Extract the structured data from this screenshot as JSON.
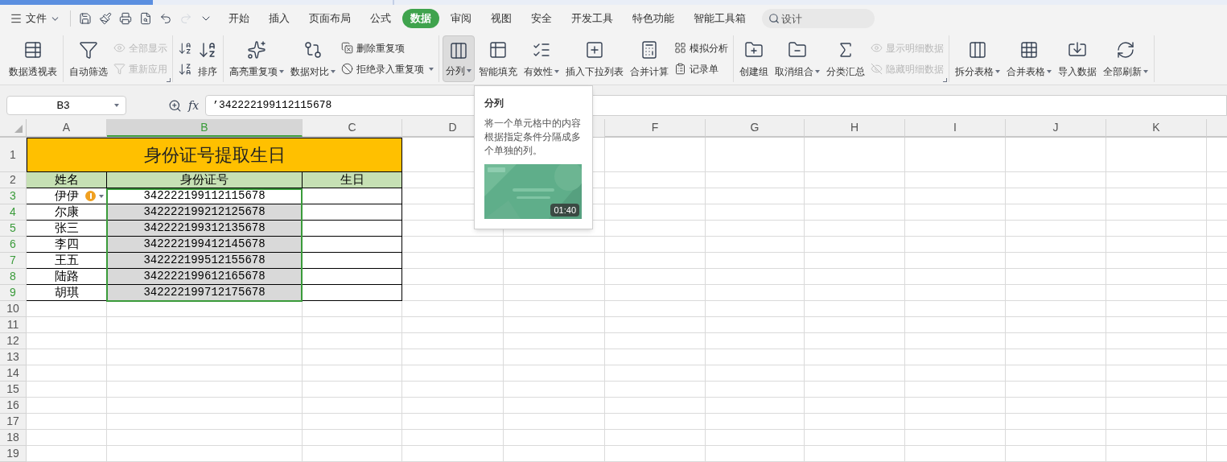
{
  "menu": {
    "file_label": "文件",
    "tabs": [
      {
        "label": "开始",
        "selected": false
      },
      {
        "label": "插入",
        "selected": false
      },
      {
        "label": "页面布局",
        "selected": false
      },
      {
        "label": "公式",
        "selected": false
      },
      {
        "label": "数据",
        "selected": true
      },
      {
        "label": "审阅",
        "selected": false
      },
      {
        "label": "视图",
        "selected": false
      },
      {
        "label": "安全",
        "selected": false
      },
      {
        "label": "开发工具",
        "selected": false
      },
      {
        "label": "特色功能",
        "selected": false
      },
      {
        "label": "智能工具箱",
        "selected": false
      }
    ],
    "search": {
      "placeholder": "设计"
    }
  },
  "ribbon": [
    {
      "launcher": false,
      "items": [
        {
          "kind": "large",
          "label": "数据透视表",
          "dropdown": false,
          "selected": false
        }
      ]
    },
    {
      "launcher": true,
      "items": [
        {
          "kind": "large",
          "label": "自动筛选",
          "dropdown": false,
          "selected": false
        },
        {
          "kind": "stack",
          "entries": [
            {
              "label": "全部显示",
              "disabled": true,
              "dropdown": false
            },
            {
              "label": "重新应用",
              "disabled": true,
              "dropdown": false
            }
          ]
        }
      ]
    },
    {
      "launcher": false,
      "items": [
        {
          "kind": "icons"
        },
        {
          "kind": "large",
          "label": "排序",
          "dropdown": false,
          "selected": false
        }
      ]
    },
    {
      "launcher": false,
      "items": [
        {
          "kind": "large",
          "label": "高亮重复项",
          "dropdown": true,
          "selected": false
        },
        {
          "kind": "large",
          "label": "数据对比",
          "dropdown": true,
          "selected": false
        },
        {
          "kind": "stack",
          "entries": [
            {
              "label": "删除重复项",
              "disabled": false,
              "dropdown": false
            },
            {
              "label": "拒绝录入重复项",
              "disabled": false,
              "dropdown": true
            }
          ]
        }
      ]
    },
    {
      "launcher": false,
      "items": [
        {
          "kind": "large",
          "label": "分列",
          "dropdown": true,
          "selected": true
        },
        {
          "kind": "large",
          "label": "智能填充",
          "dropdown": false,
          "selected": false
        },
        {
          "kind": "large",
          "label": "有效性",
          "dropdown": true,
          "selected": false
        },
        {
          "kind": "large",
          "label": "插入下拉列表",
          "dropdown": false,
          "selected": false
        },
        {
          "kind": "large",
          "label": "合并计算",
          "dropdown": false,
          "selected": false
        },
        {
          "kind": "stack",
          "entries": [
            {
              "label": "模拟分析",
              "disabled": false,
              "dropdown": false
            },
            {
              "label": "记录单",
              "disabled": false,
              "dropdown": false
            }
          ]
        }
      ]
    },
    {
      "launcher": true,
      "items": [
        {
          "kind": "large",
          "label": "创建组",
          "dropdown": false,
          "selected": false
        },
        {
          "kind": "large",
          "label": "取消组合",
          "dropdown": true,
          "selected": false
        },
        {
          "kind": "large",
          "label": "分类汇总",
          "dropdown": false,
          "selected": false
        },
        {
          "kind": "stack",
          "entries": [
            {
              "label": "显示明细数据",
              "disabled": true,
              "dropdown": false
            },
            {
              "label": "隐藏明细数据",
              "disabled": true,
              "dropdown": false
            }
          ]
        }
      ]
    },
    {
      "launcher": false,
      "items": [
        {
          "kind": "large",
          "label": "拆分表格",
          "dropdown": true,
          "selected": false
        },
        {
          "kind": "large",
          "label": "合并表格",
          "dropdown": true,
          "selected": false
        },
        {
          "kind": "large",
          "label": "导入数据",
          "dropdown": false,
          "selected": false
        },
        {
          "kind": "large",
          "label": "全部刷新",
          "dropdown": true,
          "selected": false
        }
      ]
    }
  ],
  "formula_bar": {
    "name_box": "B3",
    "formula": "’342222199112115678",
    "fx_label": "fx"
  },
  "tooltip": {
    "title": "分列",
    "body": "将一个单元格中的内容根据指定条件分隔成多个单独的列。",
    "duration": "01:40"
  },
  "sheet": {
    "columns": [
      {
        "label": "A",
        "selected": false
      },
      {
        "label": "B",
        "selected": true
      },
      {
        "label": "C",
        "selected": false
      },
      {
        "label": "D",
        "selected": false
      },
      {
        "kind": "covered"
      },
      {
        "label": "F",
        "selected": false
      },
      {
        "label": "G",
        "selected": false
      },
      {
        "label": "H",
        "selected": false
      },
      {
        "label": "I",
        "selected": false
      },
      {
        "label": "J",
        "selected": false
      },
      {
        "label": "K",
        "selected": false
      }
    ],
    "title_row": {
      "number": "1",
      "text": "身份证号提取生日"
    },
    "header_row": {
      "number": "2",
      "cells": [
        "姓名",
        "身份证号",
        "生日"
      ]
    },
    "rows": [
      {
        "number": "3",
        "name": "伊伊",
        "id": "342222199112115678",
        "selected": true,
        "active": true,
        "warning": true
      },
      {
        "number": "4",
        "name": "尔康",
        "id": "342222199212125678",
        "selected": true,
        "active": false,
        "warning": false
      },
      {
        "number": "5",
        "name": "张三",
        "id": "342222199312135678",
        "selected": true,
        "active": false,
        "warning": false
      },
      {
        "number": "6",
        "name": "李四",
        "id": "342222199412145678",
        "selected": true,
        "active": false,
        "warning": false
      },
      {
        "number": "7",
        "name": "王五",
        "id": "342222199512155678",
        "selected": true,
        "active": false,
        "warning": false
      },
      {
        "number": "8",
        "name": "陆路",
        "id": "342222199612165678",
        "selected": true,
        "active": false,
        "warning": false
      },
      {
        "number": "9",
        "name": "胡琪",
        "id": "342222199712175678",
        "selected": true,
        "active": false,
        "warning": false
      }
    ],
    "empty_rows": [
      "10",
      "11",
      "12",
      "13",
      "14",
      "15",
      "16",
      "17",
      "18",
      "19"
    ]
  }
}
